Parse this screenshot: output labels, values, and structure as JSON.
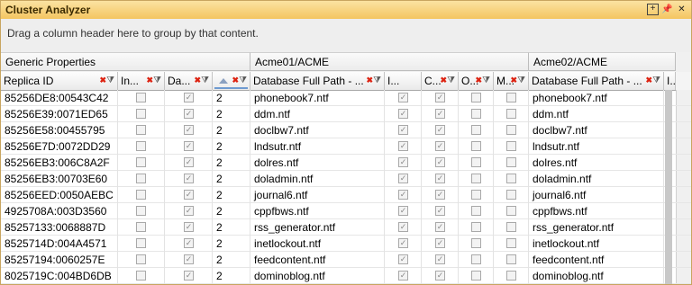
{
  "window": {
    "title": "Cluster Analyzer"
  },
  "icons": {
    "expand": "maximize-icon",
    "pin": "pin-icon",
    "close": "close-icon",
    "filter": "filter-icon"
  },
  "groupby": {
    "hint": "Drag a column header here to group by that content."
  },
  "bands": [
    "Generic Properties",
    "Acme01/ACME",
    "Acme02/ACME"
  ],
  "columns": [
    "Replica ID",
    "In...",
    "Da...",
    "",
    "Database Full Path - ...",
    "I...",
    "C...",
    "O...",
    "M...",
    "Database Full Path - ...",
    "I..."
  ],
  "rows": [
    {
      "id": "85256DE8:00543C42",
      "num": "2",
      "path1": "phonebook7.ntf",
      "path2": "phonebook7.ntf"
    },
    {
      "id": "85256E39:0071ED65",
      "num": "2",
      "path1": "ddm.ntf",
      "path2": "ddm.ntf"
    },
    {
      "id": "85256E58:00455795",
      "num": "2",
      "path1": "doclbw7.ntf",
      "path2": "doclbw7.ntf"
    },
    {
      "id": "85256E7D:0072DD29",
      "num": "2",
      "path1": "lndsutr.ntf",
      "path2": "lndsutr.ntf"
    },
    {
      "id": "85256EB3:006C8A2F",
      "num": "2",
      "path1": "dolres.ntf",
      "path2": "dolres.ntf"
    },
    {
      "id": "85256EB3:00703E60",
      "num": "2",
      "path1": "doladmin.ntf",
      "path2": "doladmin.ntf"
    },
    {
      "id": "85256EED:0050AEBC",
      "num": "2",
      "path1": "journal6.ntf",
      "path2": "journal6.ntf"
    },
    {
      "id": "4925708A:003D3560",
      "num": "2",
      "path1": "cppfbws.ntf",
      "path2": "cppfbws.ntf"
    },
    {
      "id": "85257133:0068887D",
      "num": "2",
      "path1": "rss_generator.ntf",
      "path2": "rss_generator.ntf"
    },
    {
      "id": "8525714D:004A4571",
      "num": "2",
      "path1": "inetlockout.ntf",
      "path2": "inetlockout.ntf"
    },
    {
      "id": "85257194:0060257E",
      "num": "2",
      "path1": "feedcontent.ntf",
      "path2": "feedcontent.ntf"
    },
    {
      "id": "8025719C:004BD6DB",
      "num": "2",
      "path1": "dominoblog.ntf",
      "path2": "dominoblog.ntf"
    }
  ]
}
